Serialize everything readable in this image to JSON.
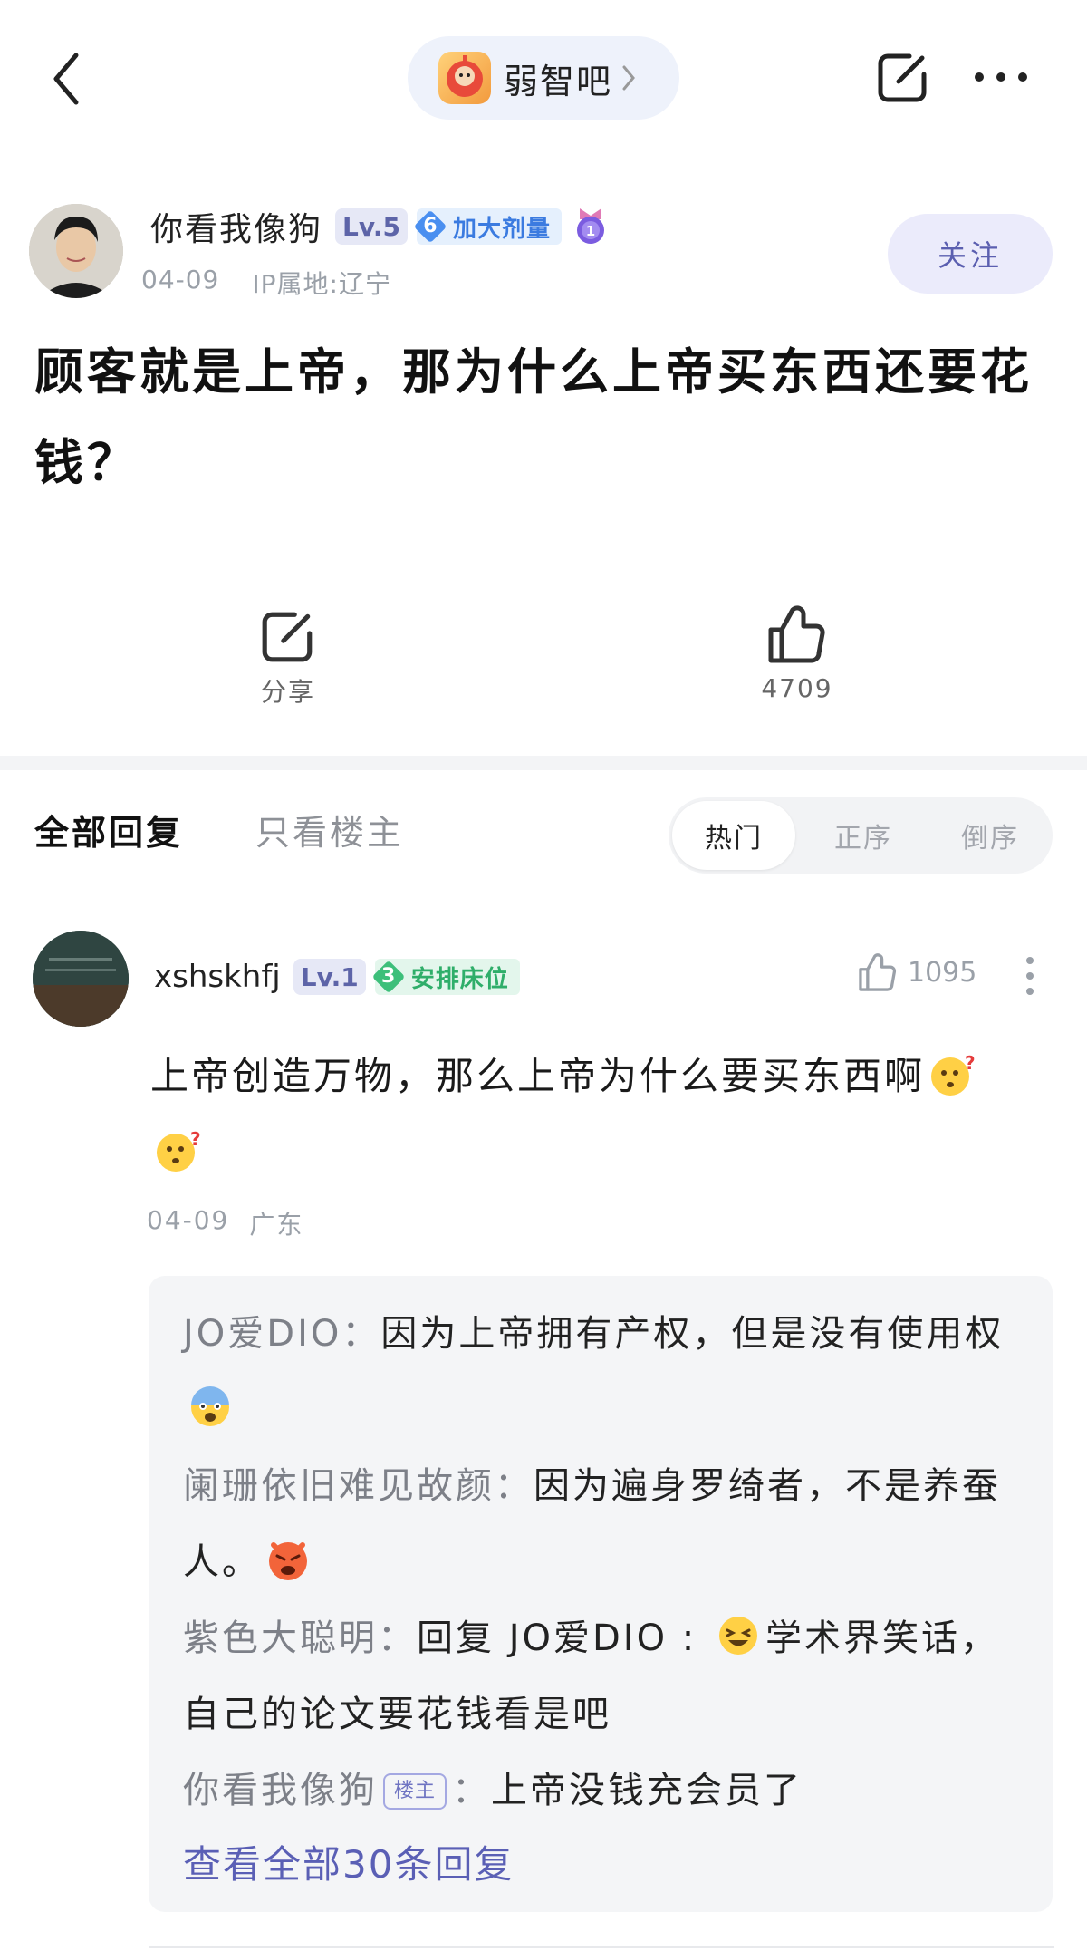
{
  "topbar": {
    "forum_name": "弱智吧"
  },
  "post": {
    "author_name": "你看我像狗",
    "level": "Lv.5",
    "title_badge_number": "6",
    "title_badge_text": "加大剂量",
    "date": "04-09",
    "ip_location": "IP属地:辽宁",
    "follow_label": "关注",
    "title": "顾客就是上帝，那为什么上帝买东西还要花钱？",
    "share_label": "分享",
    "like_count": "4709"
  },
  "tabs": {
    "all": "全部回复",
    "owner_only": "只看楼主"
  },
  "sort": {
    "hot": "热门",
    "asc": "正序",
    "desc": "倒序"
  },
  "comment": {
    "author": "xshskhfj",
    "level": "Lv.1",
    "title_badge_number": "3",
    "title_badge_text": "安排床位",
    "like_count": "1095",
    "text": "上帝创造万物，那么上帝为什么要买东西啊",
    "date": "04-09",
    "location": "广东",
    "replies": [
      {
        "author": "JO爱DIO",
        "text": "因为上帝拥有产权，但是没有使用权"
      },
      {
        "author": "阑珊依旧难见故颜",
        "text": "因为遍身罗绮者，不是养蚕人。"
      },
      {
        "author": "紫色大聪明",
        "reply_prefix": "回复 ",
        "reply_to": "JO爱DIO",
        "text": "学术界笑话，自己的论文要花钱看是吧"
      },
      {
        "author": "你看我像狗",
        "owner_tag": "楼主",
        "text": "上帝没钱充会员了"
      }
    ],
    "view_all": "查看全部30条回复"
  },
  "colors": {
    "accent": "#5a5fb5",
    "follow_bg": "#ebebfb",
    "level_badge_bg": "#e6e8f6",
    "title_badge_blue": "#4a8ff0",
    "title_badge_green": "#3dbf7a",
    "muted_text": "#9aa0a8"
  },
  "icons": {
    "back": "chevron-left-icon",
    "share": "share-icon",
    "more": "more-horizontal-icon",
    "like": "thumbs-up-icon",
    "comment_more": "more-vertical-icon",
    "emoji_thinking": "thinking-face-emoji",
    "emoji_scared": "scared-face-emoji",
    "emoji_angry": "angry-face-emoji",
    "emoji_grin": "grinning-face-emoji"
  }
}
